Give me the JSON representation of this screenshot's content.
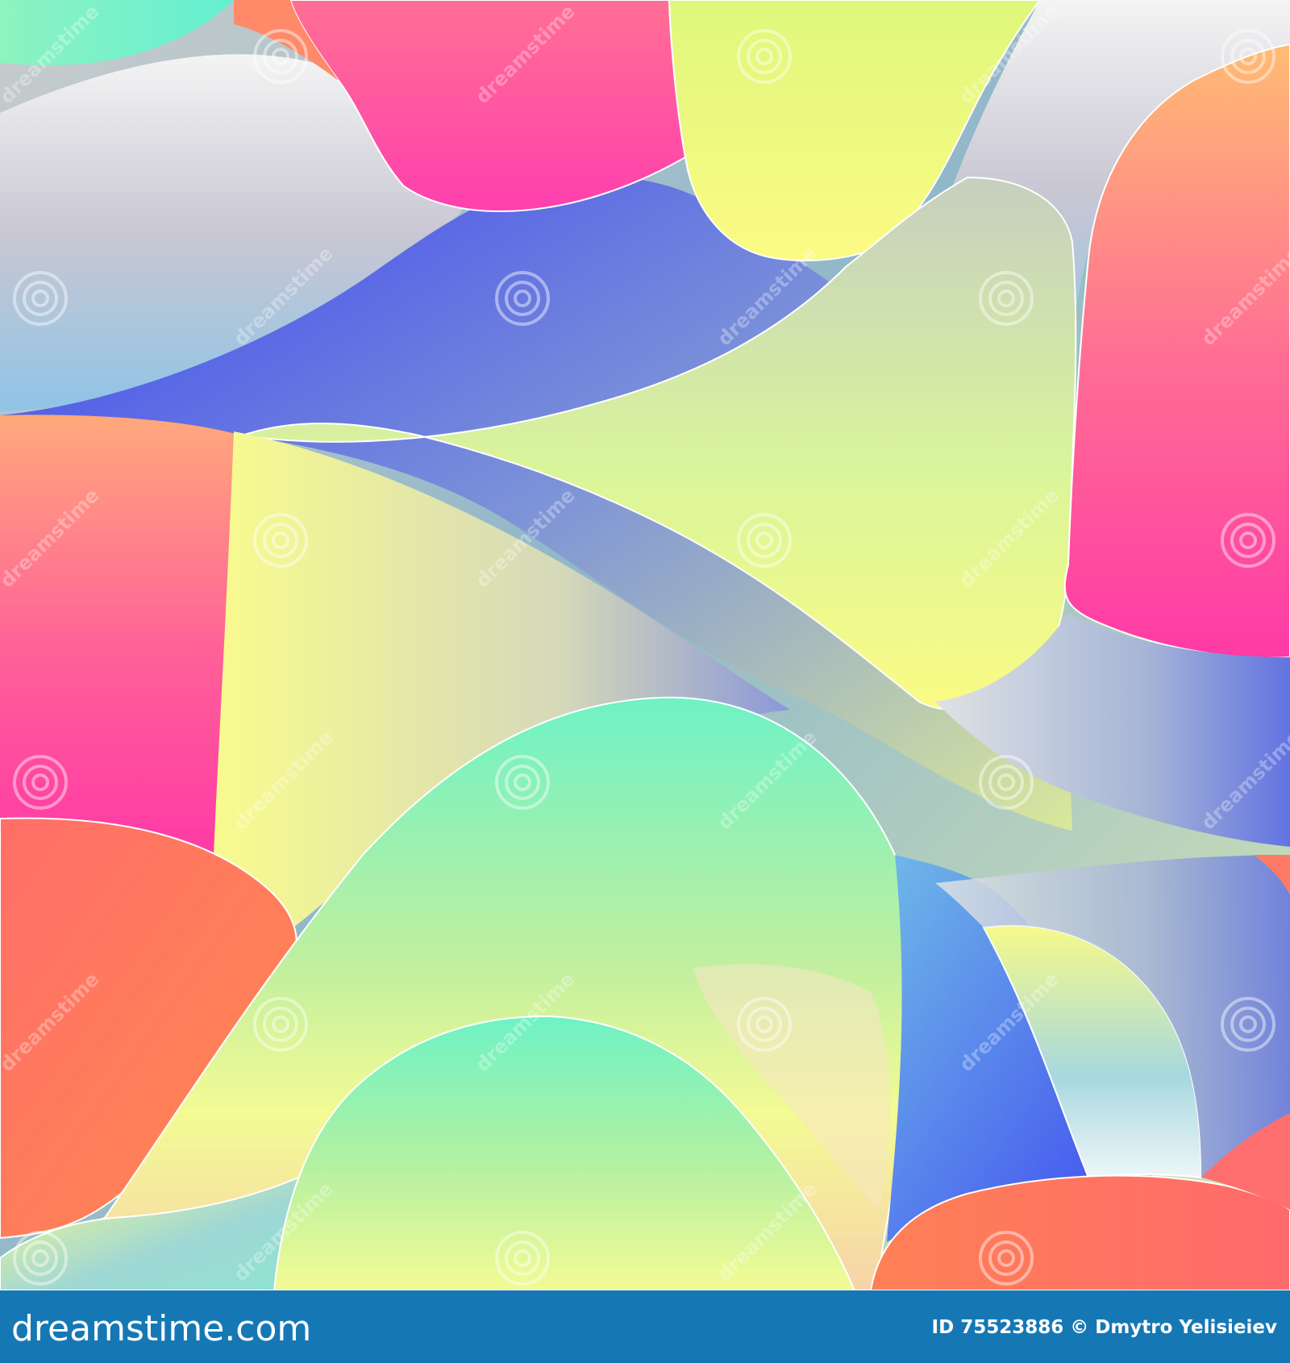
{
  "image": {
    "watermark_word": "dreamstime",
    "palette": {
      "pink": "#ff4aa0",
      "coral": "#ff7f57",
      "yellow": "#f2fb8c",
      "mint": "#70f0c8",
      "blue": "#4657ee",
      "gray": "#c6c8c8"
    }
  },
  "footer": {
    "brand": "dreamstime.com",
    "credit": "ID 75523886 © Dmytro Yelisieiev",
    "background_color": "#1578b5"
  }
}
